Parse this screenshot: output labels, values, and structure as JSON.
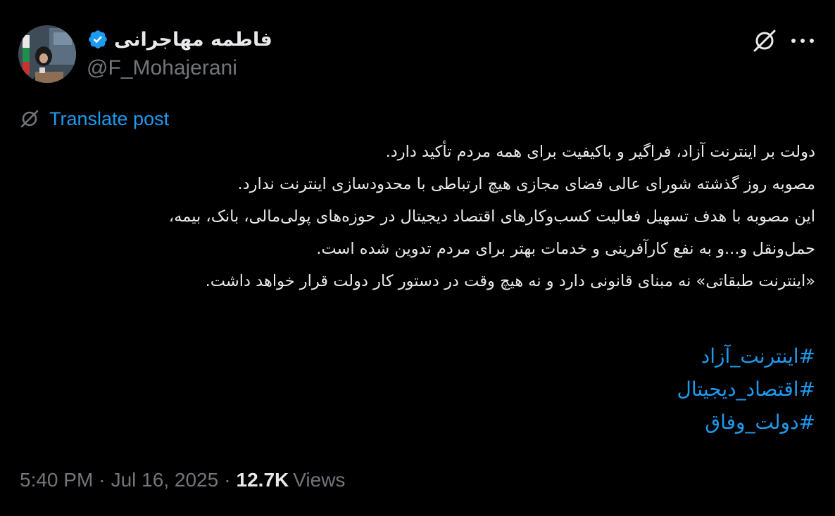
{
  "author": {
    "display_name": "فاطمه مهاجرانی",
    "handle": "@F_Mohajerani",
    "verified": true
  },
  "header": {
    "grok_icon": "grok-icon",
    "more_icon": "more-icon"
  },
  "translate": {
    "label": "Translate post",
    "icon": "translate-icon"
  },
  "post": {
    "lines": [
      "دولت بر اینترنت آزاد، فراگیر و باکیفیت برای همه مردم تأکید دارد.",
      "مصوبه روز گذشته شورای عالی فضای مجازی هیچ ارتباطی با محدودسازی اینترنت ندارد.",
      "این مصوبه با هدف تسهیل فعالیت کسب‌وکارهای اقتصاد دیجیتال در حوزه‌های پولی‌مالی، بانک، بیمه،",
      "حمل‌ونقل و...و به نفع کارآفرینی و خدمات بهتر برای مردم تدوین شده است.",
      "«اینترنت طبقاتی» نه مبنای قانونی دارد و نه هیچ وقت در دستور کار دولت قرار خواهد داشت."
    ],
    "hashtags": [
      "#اینترنت_آزاد",
      "#اقتصاد_دیجیتال",
      "#دولت_وفاق"
    ]
  },
  "meta": {
    "time": "5:40 PM",
    "separator": "·",
    "date": "Jul 16, 2025",
    "views_count": "12.7K",
    "views_label": "Views"
  },
  "colors": {
    "background": "#000000",
    "text": "#e7e9ea",
    "muted": "#71767b",
    "link": "#1d9bf0",
    "verified": "#1d9bf0"
  }
}
